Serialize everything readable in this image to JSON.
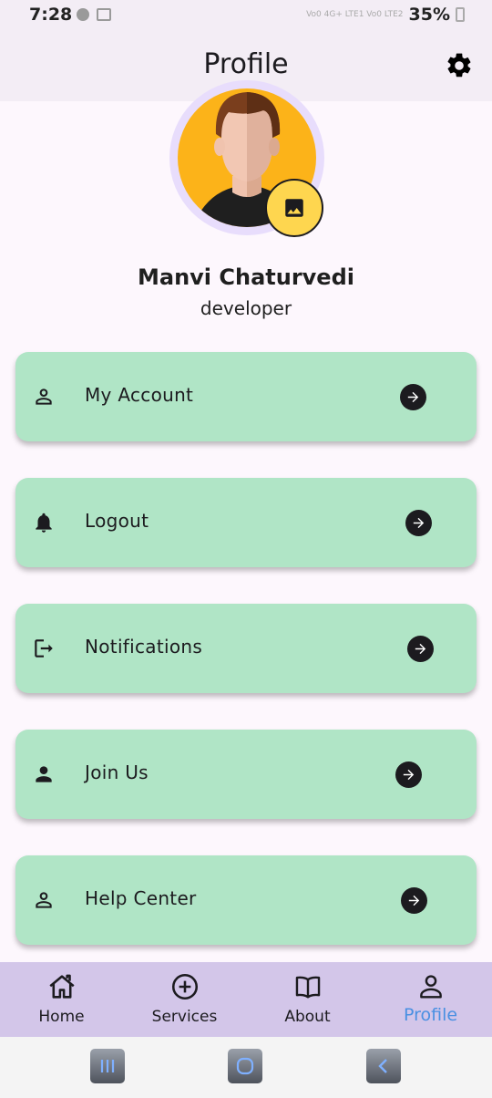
{
  "status_bar": {
    "time": "7:28",
    "signal_text": "Vo0 4G+ LTE1 Vo0 LTE2",
    "battery": "35%"
  },
  "app_bar": {
    "title": "Profile"
  },
  "profile": {
    "name": "Manvi Chaturvedi",
    "role": "developer"
  },
  "menu": [
    {
      "label": "My Account",
      "icon": "person-outline-icon"
    },
    {
      "label": "Logout",
      "icon": "bell-icon"
    },
    {
      "label": "Notifications",
      "icon": "logout-icon"
    },
    {
      "label": "Join Us",
      "icon": "person-icon"
    },
    {
      "label": "Help Center",
      "icon": "person-outline-icon"
    }
  ],
  "bottom_nav": [
    {
      "label": "Home",
      "icon": "home-icon"
    },
    {
      "label": "Services",
      "icon": "add-circle-icon"
    },
    {
      "label": "About",
      "icon": "book-icon"
    },
    {
      "label": "Profile",
      "icon": "person-outline-icon",
      "active": true
    }
  ],
  "colors": {
    "card": "#b0e5c6",
    "nav_bg": "#d3c6e9",
    "active_nav": "#4a90e2",
    "avatar_bg": "#fcb319",
    "photo_button": "#fed64f"
  }
}
